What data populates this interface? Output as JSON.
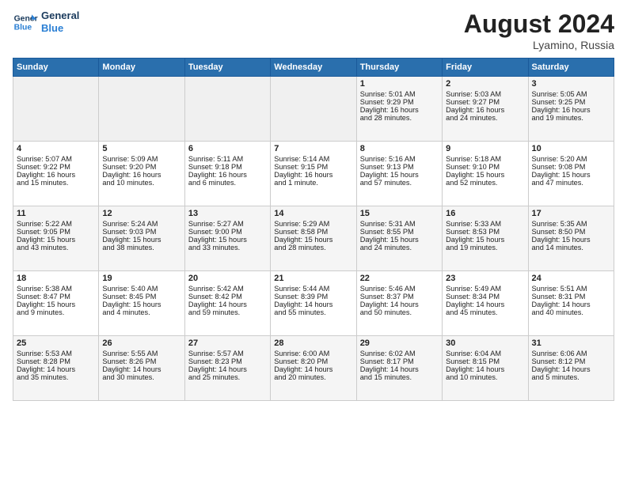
{
  "logo": {
    "line1": "General",
    "line2": "Blue"
  },
  "title": "August 2024",
  "location": "Lyamino, Russia",
  "weekdays": [
    "Sunday",
    "Monday",
    "Tuesday",
    "Wednesday",
    "Thursday",
    "Friday",
    "Saturday"
  ],
  "weeks": [
    [
      {
        "day": "",
        "content": ""
      },
      {
        "day": "",
        "content": ""
      },
      {
        "day": "",
        "content": ""
      },
      {
        "day": "",
        "content": ""
      },
      {
        "day": "1",
        "content": "Sunrise: 5:01 AM\nSunset: 9:29 PM\nDaylight: 16 hours\nand 28 minutes."
      },
      {
        "day": "2",
        "content": "Sunrise: 5:03 AM\nSunset: 9:27 PM\nDaylight: 16 hours\nand 24 minutes."
      },
      {
        "day": "3",
        "content": "Sunrise: 5:05 AM\nSunset: 9:25 PM\nDaylight: 16 hours\nand 19 minutes."
      }
    ],
    [
      {
        "day": "4",
        "content": "Sunrise: 5:07 AM\nSunset: 9:22 PM\nDaylight: 16 hours\nand 15 minutes."
      },
      {
        "day": "5",
        "content": "Sunrise: 5:09 AM\nSunset: 9:20 PM\nDaylight: 16 hours\nand 10 minutes."
      },
      {
        "day": "6",
        "content": "Sunrise: 5:11 AM\nSunset: 9:18 PM\nDaylight: 16 hours\nand 6 minutes."
      },
      {
        "day": "7",
        "content": "Sunrise: 5:14 AM\nSunset: 9:15 PM\nDaylight: 16 hours\nand 1 minute."
      },
      {
        "day": "8",
        "content": "Sunrise: 5:16 AM\nSunset: 9:13 PM\nDaylight: 15 hours\nand 57 minutes."
      },
      {
        "day": "9",
        "content": "Sunrise: 5:18 AM\nSunset: 9:10 PM\nDaylight: 15 hours\nand 52 minutes."
      },
      {
        "day": "10",
        "content": "Sunrise: 5:20 AM\nSunset: 9:08 PM\nDaylight: 15 hours\nand 47 minutes."
      }
    ],
    [
      {
        "day": "11",
        "content": "Sunrise: 5:22 AM\nSunset: 9:05 PM\nDaylight: 15 hours\nand 43 minutes."
      },
      {
        "day": "12",
        "content": "Sunrise: 5:24 AM\nSunset: 9:03 PM\nDaylight: 15 hours\nand 38 minutes."
      },
      {
        "day": "13",
        "content": "Sunrise: 5:27 AM\nSunset: 9:00 PM\nDaylight: 15 hours\nand 33 minutes."
      },
      {
        "day": "14",
        "content": "Sunrise: 5:29 AM\nSunset: 8:58 PM\nDaylight: 15 hours\nand 28 minutes."
      },
      {
        "day": "15",
        "content": "Sunrise: 5:31 AM\nSunset: 8:55 PM\nDaylight: 15 hours\nand 24 minutes."
      },
      {
        "day": "16",
        "content": "Sunrise: 5:33 AM\nSunset: 8:53 PM\nDaylight: 15 hours\nand 19 minutes."
      },
      {
        "day": "17",
        "content": "Sunrise: 5:35 AM\nSunset: 8:50 PM\nDaylight: 15 hours\nand 14 minutes."
      }
    ],
    [
      {
        "day": "18",
        "content": "Sunrise: 5:38 AM\nSunset: 8:47 PM\nDaylight: 15 hours\nand 9 minutes."
      },
      {
        "day": "19",
        "content": "Sunrise: 5:40 AM\nSunset: 8:45 PM\nDaylight: 15 hours\nand 4 minutes."
      },
      {
        "day": "20",
        "content": "Sunrise: 5:42 AM\nSunset: 8:42 PM\nDaylight: 14 hours\nand 59 minutes."
      },
      {
        "day": "21",
        "content": "Sunrise: 5:44 AM\nSunset: 8:39 PM\nDaylight: 14 hours\nand 55 minutes."
      },
      {
        "day": "22",
        "content": "Sunrise: 5:46 AM\nSunset: 8:37 PM\nDaylight: 14 hours\nand 50 minutes."
      },
      {
        "day": "23",
        "content": "Sunrise: 5:49 AM\nSunset: 8:34 PM\nDaylight: 14 hours\nand 45 minutes."
      },
      {
        "day": "24",
        "content": "Sunrise: 5:51 AM\nSunset: 8:31 PM\nDaylight: 14 hours\nand 40 minutes."
      }
    ],
    [
      {
        "day": "25",
        "content": "Sunrise: 5:53 AM\nSunset: 8:28 PM\nDaylight: 14 hours\nand 35 minutes."
      },
      {
        "day": "26",
        "content": "Sunrise: 5:55 AM\nSunset: 8:26 PM\nDaylight: 14 hours\nand 30 minutes."
      },
      {
        "day": "27",
        "content": "Sunrise: 5:57 AM\nSunset: 8:23 PM\nDaylight: 14 hours\nand 25 minutes."
      },
      {
        "day": "28",
        "content": "Sunrise: 6:00 AM\nSunset: 8:20 PM\nDaylight: 14 hours\nand 20 minutes."
      },
      {
        "day": "29",
        "content": "Sunrise: 6:02 AM\nSunset: 8:17 PM\nDaylight: 14 hours\nand 15 minutes."
      },
      {
        "day": "30",
        "content": "Sunrise: 6:04 AM\nSunset: 8:15 PM\nDaylight: 14 hours\nand 10 minutes."
      },
      {
        "day": "31",
        "content": "Sunrise: 6:06 AM\nSunset: 8:12 PM\nDaylight: 14 hours\nand 5 minutes."
      }
    ]
  ]
}
